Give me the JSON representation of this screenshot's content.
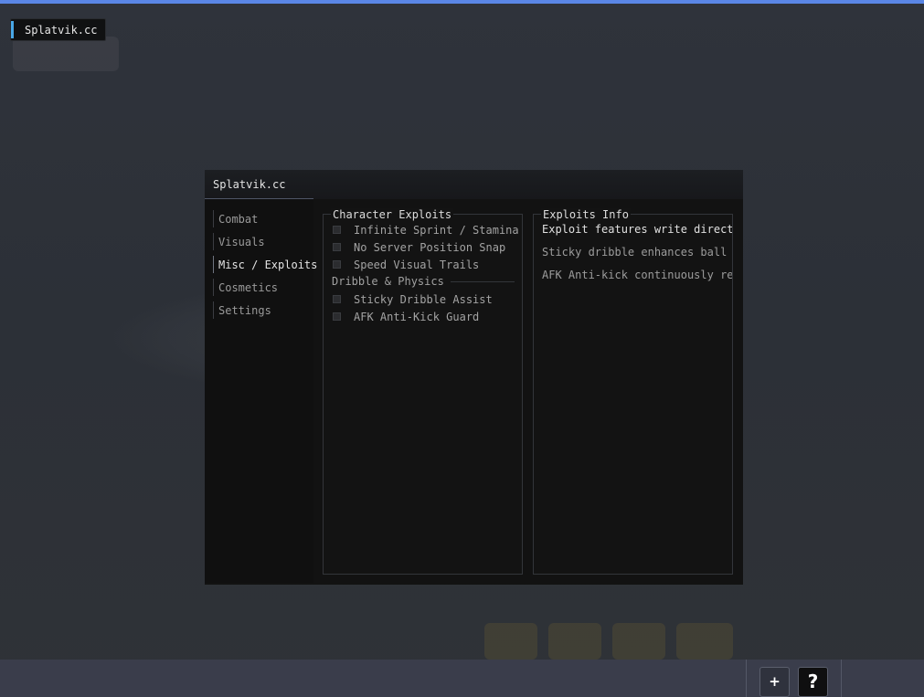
{
  "overlay_tag": {
    "label": "Splatvik.cc",
    "accent_color": "#48a7e6"
  },
  "window": {
    "title": "Splatvik.cc",
    "nav": [
      {
        "label": "Combat",
        "active": false
      },
      {
        "label": "Visuals",
        "active": false
      },
      {
        "label": "Misc / Exploits",
        "active": true
      },
      {
        "label": "Cosmetics",
        "active": false
      },
      {
        "label": "Settings",
        "active": false
      }
    ],
    "left_panel": {
      "title": "Character Exploits",
      "items": [
        {
          "label": "Infinite Sprint / Stamina",
          "checked": false
        },
        {
          "label": "No Server Position Snap",
          "checked": false
        },
        {
          "label": "Speed Visual Trails",
          "checked": false
        }
      ],
      "section2_title": "Dribble & Physics",
      "section2_items": [
        {
          "label": "Sticky Dribble Assist",
          "checked": false
        },
        {
          "label": "AFK Anti-Kick Guard",
          "checked": false
        }
      ]
    },
    "right_panel": {
      "title": "Exploits Info",
      "lines": [
        "Exploit features write directl",
        "Sticky dribble enhances ball c",
        "AFK Anti-kick continuously res"
      ]
    }
  },
  "taskbar": {
    "add_label": "+",
    "help_label": "?"
  },
  "colors": {
    "top_accent": "#5a86e6",
    "panel_bg": "#121212",
    "taskbar_bg": "#3a3d4b"
  }
}
